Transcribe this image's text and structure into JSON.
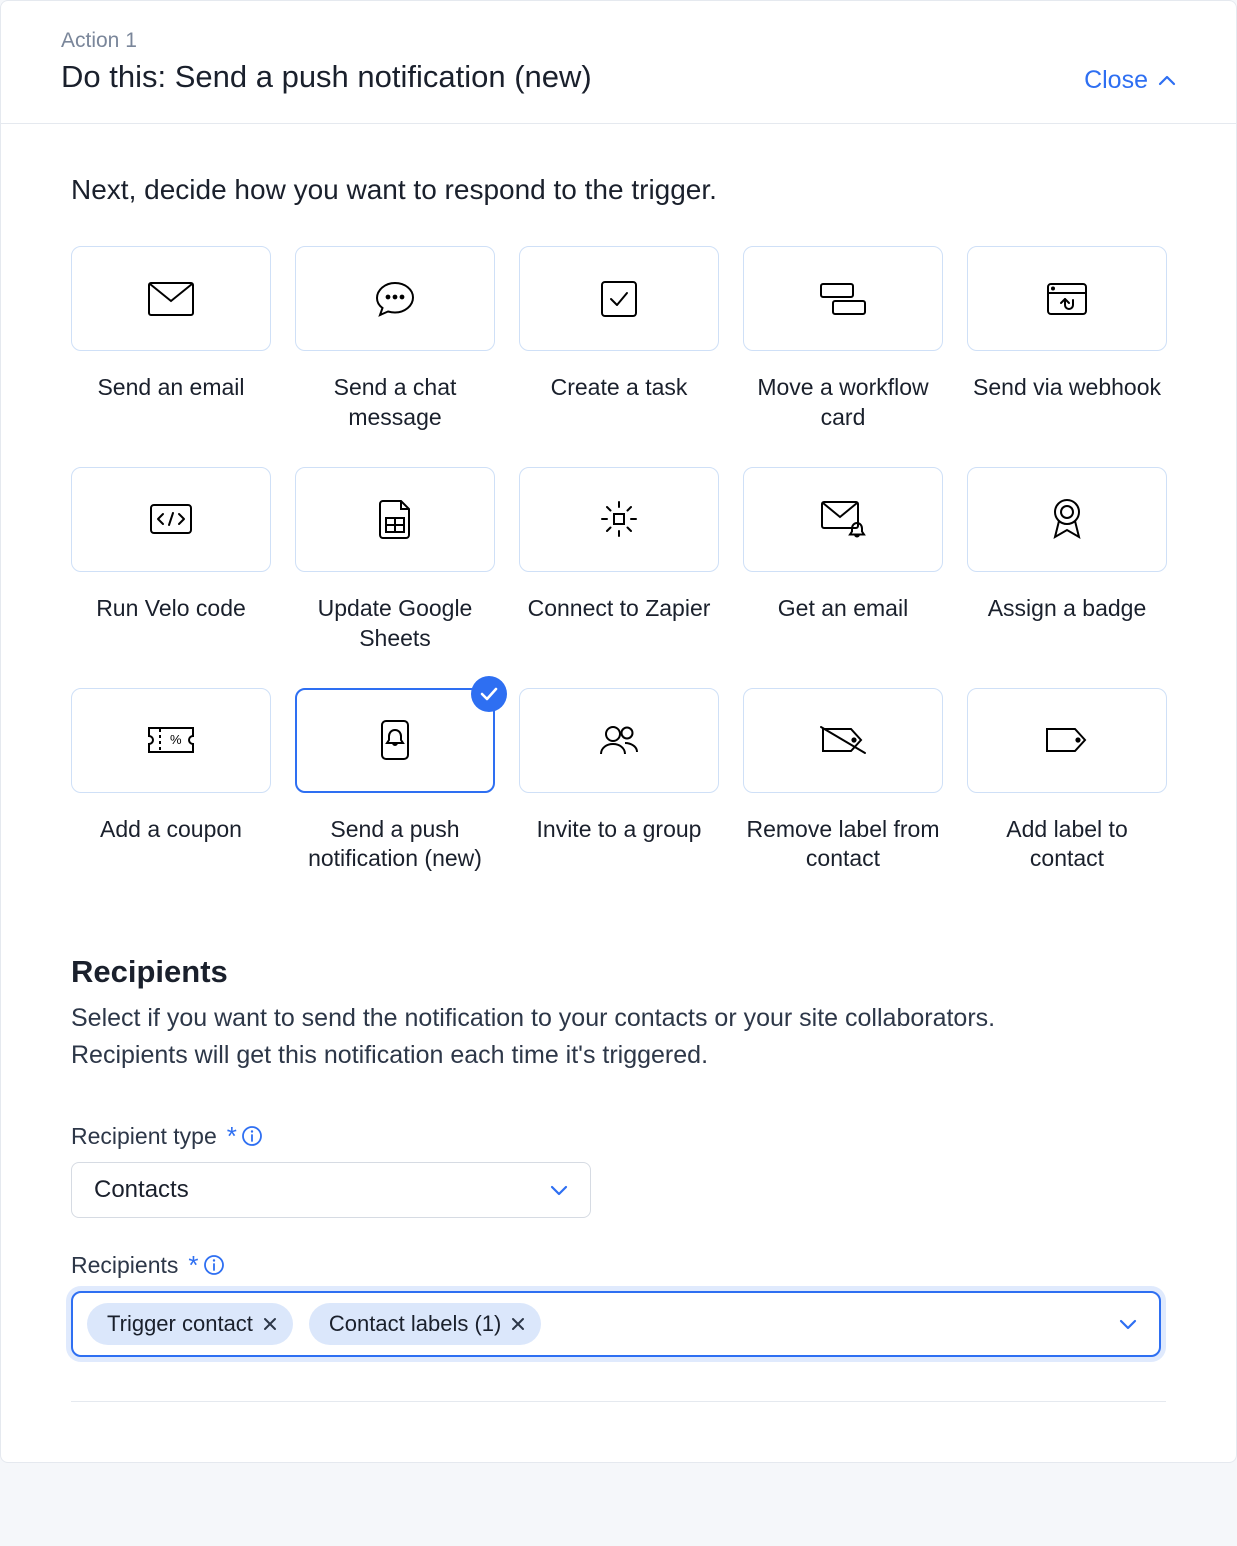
{
  "header": {
    "step": "Action 1",
    "title": "Do this: Send a push notification (new)",
    "close_label": "Close"
  },
  "body": {
    "lead": "Next, decide how you want to respond to the trigger."
  },
  "actions": [
    {
      "id": "send-email",
      "label": "Send an email",
      "selected": false,
      "icon": "envelope"
    },
    {
      "id": "send-chat",
      "label": "Send a chat message",
      "selected": false,
      "icon": "chat"
    },
    {
      "id": "create-task",
      "label": "Create a task",
      "selected": false,
      "icon": "checkbox"
    },
    {
      "id": "move-workflow",
      "label": "Move a workflow card",
      "selected": false,
      "icon": "boards"
    },
    {
      "id": "send-webhook",
      "label": "Send via webhook",
      "selected": false,
      "icon": "webhook"
    },
    {
      "id": "run-velo",
      "label": "Run Velo code",
      "selected": false,
      "icon": "code"
    },
    {
      "id": "update-sheets",
      "label": "Update Google Sheets",
      "selected": false,
      "icon": "sheet"
    },
    {
      "id": "connect-zapier",
      "label": "Connect to Zapier",
      "selected": false,
      "icon": "gear"
    },
    {
      "id": "get-email",
      "label": "Get an email",
      "selected": false,
      "icon": "mailbell"
    },
    {
      "id": "assign-badge",
      "label": "Assign a badge",
      "selected": false,
      "icon": "ribbon"
    },
    {
      "id": "add-coupon",
      "label": "Add a coupon",
      "selected": false,
      "icon": "coupon"
    },
    {
      "id": "push-notification",
      "label": "Send a push notification (new)",
      "selected": true,
      "icon": "phonebell"
    },
    {
      "id": "invite-group",
      "label": "Invite to a group",
      "selected": false,
      "icon": "people"
    },
    {
      "id": "remove-label",
      "label": "Remove label from contact",
      "selected": false,
      "icon": "tagslash"
    },
    {
      "id": "add-label",
      "label": "Add label to contact",
      "selected": false,
      "icon": "tag"
    }
  ],
  "recipients": {
    "title": "Recipients",
    "desc": "Select if you want to send the notification to your contacts or your site collaborators. Recipients will get this notification each time it's triggered.",
    "type_label": "Recipient type",
    "type_value": "Contacts",
    "list_label": "Recipients",
    "chips": [
      {
        "text": "Trigger contact"
      },
      {
        "text": "Contact labels (1)"
      }
    ]
  }
}
